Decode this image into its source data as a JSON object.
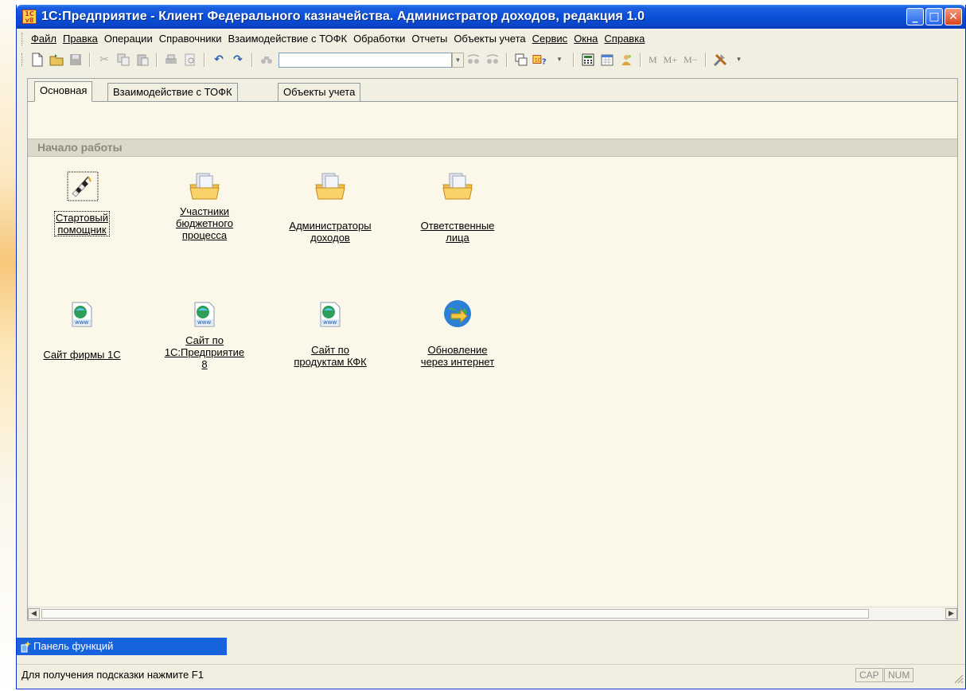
{
  "window": {
    "title": "1С:Предприятие - Клиент Федерального казначейства. Администратор доходов, редакция 1.0",
    "logo_text": "1С\nv8",
    "min_glyph": "_",
    "max_glyph": "□",
    "close_glyph": "✕"
  },
  "menu": [
    "Файл",
    "Правка",
    "Операции",
    "Справочники",
    "Взаимодействие с ТОФК",
    "Обработки",
    "Отчеты",
    "Объекты учета",
    "Сервис",
    "Окна",
    "Справка"
  ],
  "toolbar": {
    "search_value": "",
    "m_buttons": [
      "M",
      "M+",
      "M−"
    ]
  },
  "tabs": [
    "Основная",
    "Взаимодействие с ТОФК",
    "Объекты учета"
  ],
  "section_title": "Начало работы",
  "launchers": {
    "startup_assistant": "Стартовый\nпомощник",
    "budget_participants": "Участники\nбюджетного\nпроцесса",
    "revenue_admins": "Администраторы\nдоходов",
    "responsible_persons": "Ответственные\nлица",
    "site_1c": "Сайт фирмы 1С",
    "site_enterprise8": "Сайт по\n1С:Предприятие\n8",
    "site_kfk": "Сайт по\nпродуктам КФК",
    "internet_update": "Обновление\nчерез интернет"
  },
  "function_panel": "Панель функций",
  "status": {
    "hint": "Для получения подсказки нажмите F1",
    "cap": "CAP",
    "num": "NUM"
  }
}
